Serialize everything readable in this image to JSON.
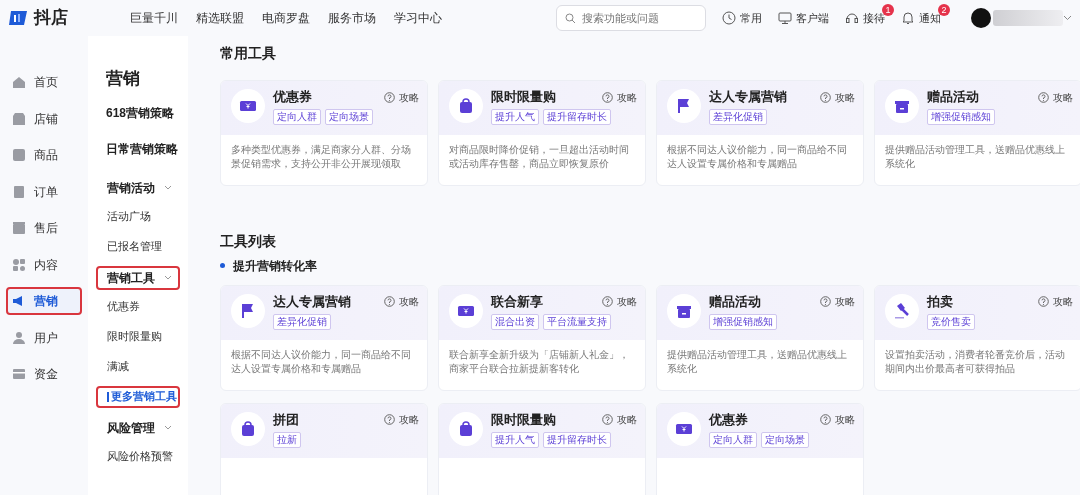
{
  "header": {
    "logo_text": "抖店",
    "nav": [
      "巨量千川",
      "精选联盟",
      "电商罗盘",
      "服务市场",
      "学习中心"
    ],
    "search": {
      "placeholder": "搜索功能或问题"
    },
    "actions": [
      {
        "label": "常用",
        "kind": "clock"
      },
      {
        "label": "客户端",
        "kind": "monitor"
      },
      {
        "label": "接待",
        "kind": "chat",
        "badge": "1"
      },
      {
        "label": "通知",
        "kind": "bell",
        "badge": "2"
      }
    ]
  },
  "main_nav": [
    {
      "label": "首页",
      "selected": false,
      "highlighted": false
    },
    {
      "label": "店铺",
      "selected": false,
      "highlighted": false
    },
    {
      "label": "商品",
      "selected": false,
      "highlighted": false
    },
    {
      "label": "订单",
      "selected": false,
      "highlighted": false
    },
    {
      "label": "售后",
      "selected": false,
      "highlighted": false
    },
    {
      "label": "内容",
      "selected": false,
      "highlighted": false
    },
    {
      "label": "营销",
      "selected": true,
      "highlighted": true
    },
    {
      "label": "用户",
      "selected": false,
      "highlighted": false
    },
    {
      "label": "资金",
      "selected": false,
      "highlighted": false
    }
  ],
  "sub_nav": {
    "title": "营销",
    "items": [
      {
        "kind": "link",
        "label": "618营销策略"
      },
      {
        "kind": "link",
        "label": "日常营销策略"
      },
      {
        "kind": "group",
        "label": "营销活动",
        "expanded": true,
        "highlighted": false,
        "children": [
          {
            "label": "活动广场",
            "selected": false,
            "highlighted": false
          },
          {
            "label": "已报名管理",
            "selected": false,
            "highlighted": false
          }
        ]
      },
      {
        "kind": "group",
        "label": "营销工具",
        "expanded": true,
        "highlighted": true,
        "children": [
          {
            "label": "优惠券",
            "selected": false,
            "highlighted": false
          },
          {
            "label": "限时限量购",
            "selected": false,
            "highlighted": false
          },
          {
            "label": "满减",
            "selected": false,
            "highlighted": false
          },
          {
            "label": "更多营销工具",
            "selected": true,
            "highlighted": true
          }
        ]
      },
      {
        "kind": "group",
        "label": "风险管理",
        "expanded": true,
        "highlighted": false,
        "children": [
          {
            "label": "风险价格预警",
            "selected": false,
            "highlighted": false
          }
        ]
      }
    ]
  },
  "sections": [
    {
      "title": "常用工具",
      "groups": [
        {
          "cards": [
            {
              "name": "优惠券",
              "kind": "coupon",
              "guide": "攻略",
              "tags": [
                "定向人群",
                "定向场景"
              ],
              "description": "多种类型优惠券，满足商家分人群、分场景促销需求，支持公开非公开展现领取"
            },
            {
              "name": "限时限量购",
              "kind": "bag",
              "guide": "攻略",
              "tags": [
                "提升人气",
                "提升留存时长"
              ],
              "description": "对商品限时降价促销，一旦超出活动时间或活动库存售罄，商品立即恢复原价"
            },
            {
              "name": "达人专属营销",
              "kind": "flag",
              "guide": "攻略",
              "tags": [
                "差异化促销"
              ],
              "description": "根据不同达人议价能力，同一商品给不同达人设置专属价格和专属赠品"
            },
            {
              "name": "赠品活动",
              "kind": "gift",
              "guide": "攻略",
              "tags": [
                "增强促销感知"
              ],
              "description": "提供赠品活动管理工具，送赠品优惠线上系统化"
            }
          ]
        }
      ]
    },
    {
      "title": "工具列表",
      "groups": [
        {
          "heading": "提升营销转化率",
          "cards": [
            {
              "name": "达人专属营销",
              "kind": "flag",
              "guide": "攻略",
              "tags": [
                "差异化促销"
              ],
              "description": "根据不同达人议价能力，同一商品给不同达人设置专属价格和专属赠品"
            },
            {
              "name": "联合新享",
              "kind": "coupon",
              "guide": "攻略",
              "tags": [
                "混合出资",
                "平台流量支持"
              ],
              "description": "联合新享全新升级为「店铺新人礼金」，商家平台联合拉新提新客转化"
            },
            {
              "name": "赠品活动",
              "kind": "gift",
              "guide": "攻略",
              "tags": [
                "增强促销感知"
              ],
              "description": "提供赠品活动管理工具，送赠品优惠线上系统化"
            },
            {
              "name": "拍卖",
              "kind": "gavel",
              "guide": "攻略",
              "tags": [
                "竞价售卖"
              ],
              "description": "设置拍卖活动，消费者轮番竞价后，活动期间内出价最高者可获得拍品"
            },
            {
              "name": "拼团",
              "kind": "bag",
              "guide": "攻略",
              "tags": [
                "拉新"
              ]
            },
            {
              "name": "限时限量购",
              "kind": "bag",
              "guide": "攻略",
              "tags": [
                "提升人气",
                "提升留存时长"
              ]
            },
            {
              "name": "优惠券",
              "kind": "coupon",
              "guide": "攻略",
              "tags": [
                "定向人群",
                "定向场景"
              ]
            }
          ]
        }
      ]
    }
  ]
}
